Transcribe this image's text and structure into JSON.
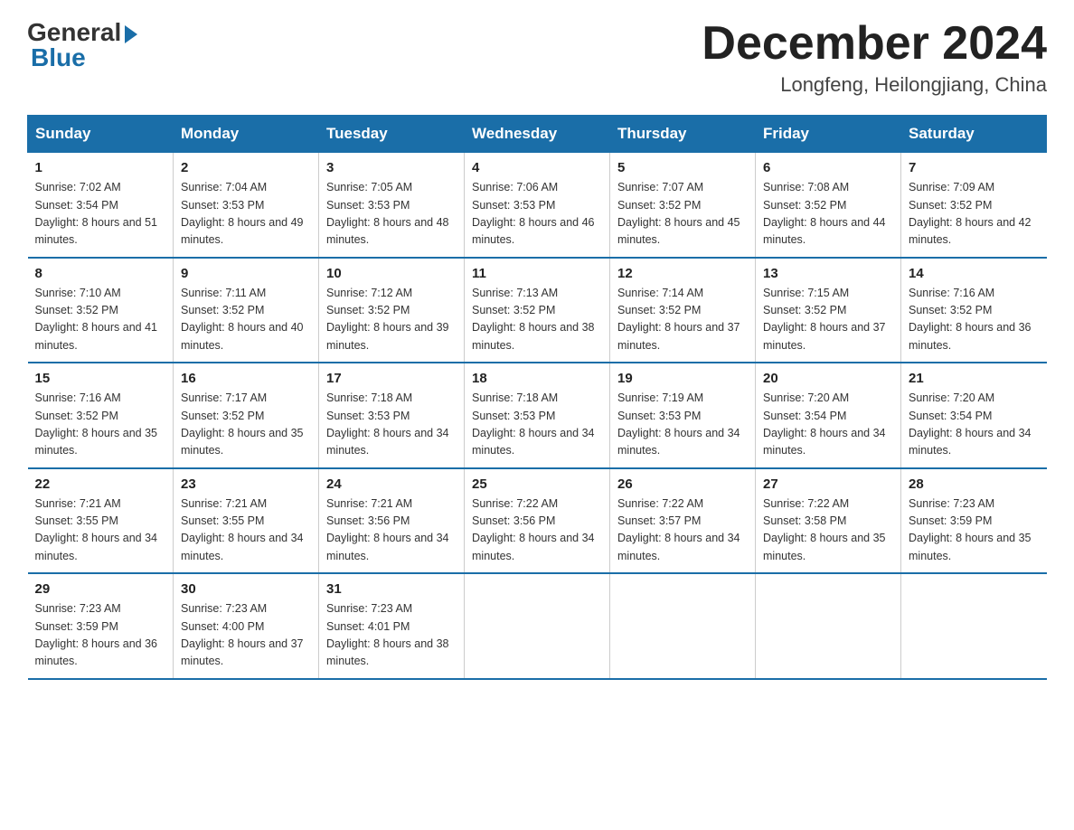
{
  "header": {
    "logo_general": "General",
    "logo_blue": "Blue",
    "month_year": "December 2024",
    "location": "Longfeng, Heilongjiang, China"
  },
  "weekdays": [
    "Sunday",
    "Monday",
    "Tuesday",
    "Wednesday",
    "Thursday",
    "Friday",
    "Saturday"
  ],
  "weeks": [
    [
      {
        "day": "1",
        "sunrise": "7:02 AM",
        "sunset": "3:54 PM",
        "daylight": "8 hours and 51 minutes."
      },
      {
        "day": "2",
        "sunrise": "7:04 AM",
        "sunset": "3:53 PM",
        "daylight": "8 hours and 49 minutes."
      },
      {
        "day": "3",
        "sunrise": "7:05 AM",
        "sunset": "3:53 PM",
        "daylight": "8 hours and 48 minutes."
      },
      {
        "day": "4",
        "sunrise": "7:06 AM",
        "sunset": "3:53 PM",
        "daylight": "8 hours and 46 minutes."
      },
      {
        "day": "5",
        "sunrise": "7:07 AM",
        "sunset": "3:52 PM",
        "daylight": "8 hours and 45 minutes."
      },
      {
        "day": "6",
        "sunrise": "7:08 AM",
        "sunset": "3:52 PM",
        "daylight": "8 hours and 44 minutes."
      },
      {
        "day": "7",
        "sunrise": "7:09 AM",
        "sunset": "3:52 PM",
        "daylight": "8 hours and 42 minutes."
      }
    ],
    [
      {
        "day": "8",
        "sunrise": "7:10 AM",
        "sunset": "3:52 PM",
        "daylight": "8 hours and 41 minutes."
      },
      {
        "day": "9",
        "sunrise": "7:11 AM",
        "sunset": "3:52 PM",
        "daylight": "8 hours and 40 minutes."
      },
      {
        "day": "10",
        "sunrise": "7:12 AM",
        "sunset": "3:52 PM",
        "daylight": "8 hours and 39 minutes."
      },
      {
        "day": "11",
        "sunrise": "7:13 AM",
        "sunset": "3:52 PM",
        "daylight": "8 hours and 38 minutes."
      },
      {
        "day": "12",
        "sunrise": "7:14 AM",
        "sunset": "3:52 PM",
        "daylight": "8 hours and 37 minutes."
      },
      {
        "day": "13",
        "sunrise": "7:15 AM",
        "sunset": "3:52 PM",
        "daylight": "8 hours and 37 minutes."
      },
      {
        "day": "14",
        "sunrise": "7:16 AM",
        "sunset": "3:52 PM",
        "daylight": "8 hours and 36 minutes."
      }
    ],
    [
      {
        "day": "15",
        "sunrise": "7:16 AM",
        "sunset": "3:52 PM",
        "daylight": "8 hours and 35 minutes."
      },
      {
        "day": "16",
        "sunrise": "7:17 AM",
        "sunset": "3:52 PM",
        "daylight": "8 hours and 35 minutes."
      },
      {
        "day": "17",
        "sunrise": "7:18 AM",
        "sunset": "3:53 PM",
        "daylight": "8 hours and 34 minutes."
      },
      {
        "day": "18",
        "sunrise": "7:18 AM",
        "sunset": "3:53 PM",
        "daylight": "8 hours and 34 minutes."
      },
      {
        "day": "19",
        "sunrise": "7:19 AM",
        "sunset": "3:53 PM",
        "daylight": "8 hours and 34 minutes."
      },
      {
        "day": "20",
        "sunrise": "7:20 AM",
        "sunset": "3:54 PM",
        "daylight": "8 hours and 34 minutes."
      },
      {
        "day": "21",
        "sunrise": "7:20 AM",
        "sunset": "3:54 PM",
        "daylight": "8 hours and 34 minutes."
      }
    ],
    [
      {
        "day": "22",
        "sunrise": "7:21 AM",
        "sunset": "3:55 PM",
        "daylight": "8 hours and 34 minutes."
      },
      {
        "day": "23",
        "sunrise": "7:21 AM",
        "sunset": "3:55 PM",
        "daylight": "8 hours and 34 minutes."
      },
      {
        "day": "24",
        "sunrise": "7:21 AM",
        "sunset": "3:56 PM",
        "daylight": "8 hours and 34 minutes."
      },
      {
        "day": "25",
        "sunrise": "7:22 AM",
        "sunset": "3:56 PM",
        "daylight": "8 hours and 34 minutes."
      },
      {
        "day": "26",
        "sunrise": "7:22 AM",
        "sunset": "3:57 PM",
        "daylight": "8 hours and 34 minutes."
      },
      {
        "day": "27",
        "sunrise": "7:22 AM",
        "sunset": "3:58 PM",
        "daylight": "8 hours and 35 minutes."
      },
      {
        "day": "28",
        "sunrise": "7:23 AM",
        "sunset": "3:59 PM",
        "daylight": "8 hours and 35 minutes."
      }
    ],
    [
      {
        "day": "29",
        "sunrise": "7:23 AM",
        "sunset": "3:59 PM",
        "daylight": "8 hours and 36 minutes."
      },
      {
        "day": "30",
        "sunrise": "7:23 AM",
        "sunset": "4:00 PM",
        "daylight": "8 hours and 37 minutes."
      },
      {
        "day": "31",
        "sunrise": "7:23 AM",
        "sunset": "4:01 PM",
        "daylight": "8 hours and 38 minutes."
      },
      null,
      null,
      null,
      null
    ]
  ]
}
